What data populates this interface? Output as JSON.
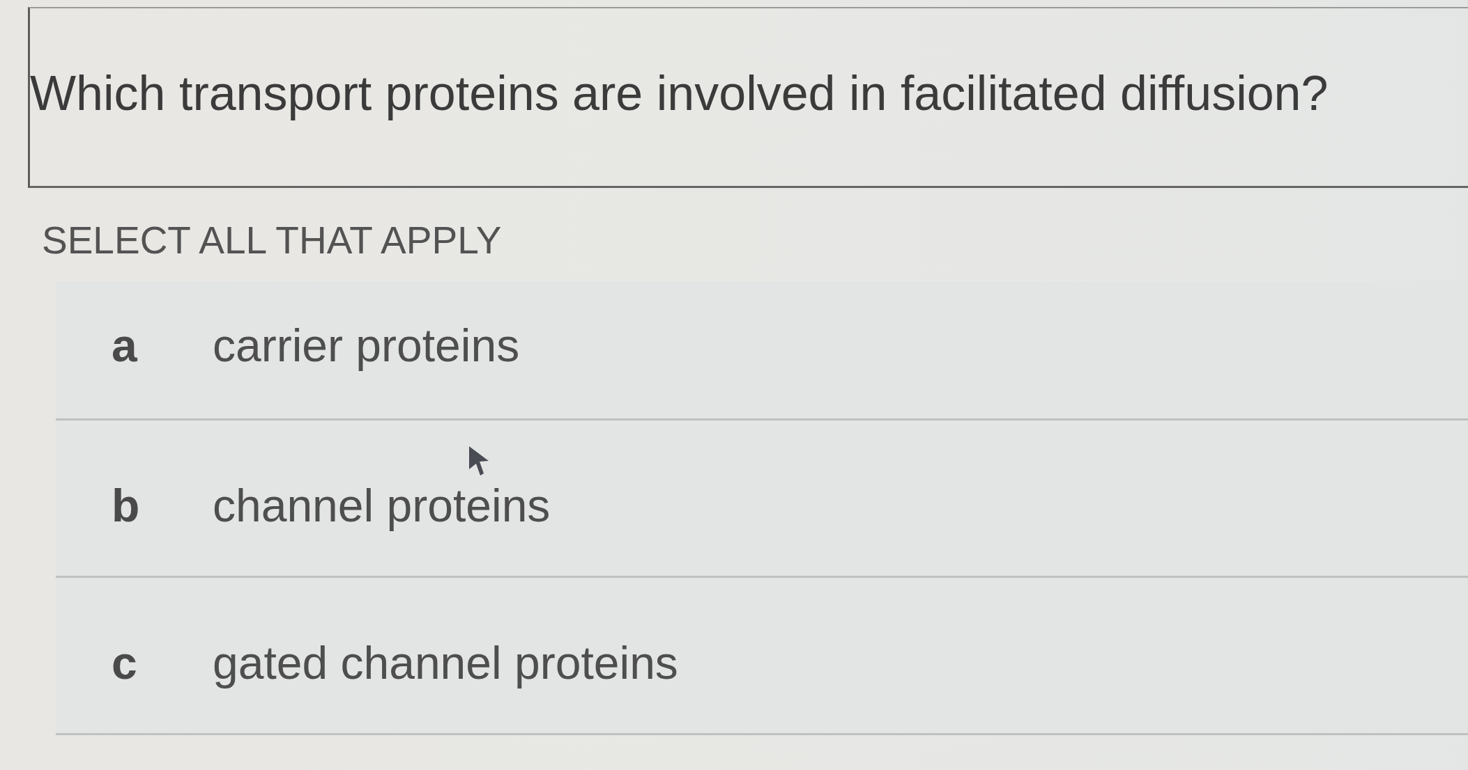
{
  "question": {
    "text": "Which transport proteins are involved in facilitated diffusion?"
  },
  "instruction": "SELECT ALL THAT APPLY",
  "options": [
    {
      "letter": "a",
      "text": "carrier proteins",
      "selected": false
    },
    {
      "letter": "b",
      "text": "channel proteins",
      "selected": false
    },
    {
      "letter": "c",
      "text": "gated channel proteins",
      "selected": false
    }
  ]
}
